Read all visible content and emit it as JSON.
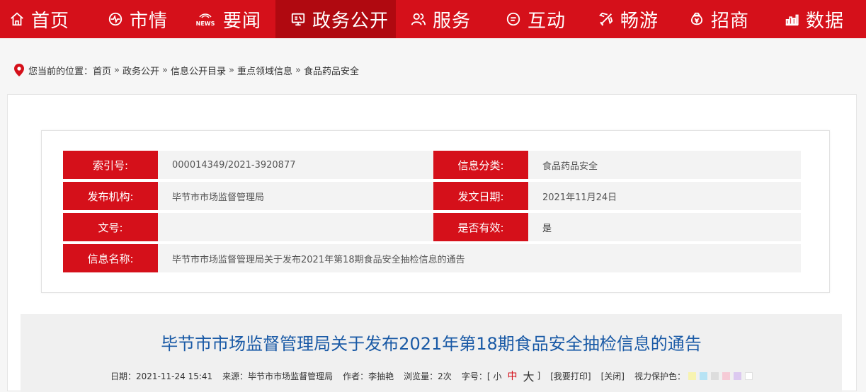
{
  "nav": {
    "items": [
      {
        "label": "首页",
        "icon": "home-icon"
      },
      {
        "label": "市情",
        "icon": "pulse-icon"
      },
      {
        "label": "要闻",
        "icon": "news-icon"
      },
      {
        "label": "政务公开",
        "icon": "monitor-icon"
      },
      {
        "label": "服务",
        "icon": "users-icon"
      },
      {
        "label": "互动",
        "icon": "chat-icon"
      },
      {
        "label": "畅游",
        "icon": "plane-icon"
      },
      {
        "label": "招商",
        "icon": "money-bag-icon"
      },
      {
        "label": "数据",
        "icon": "bar-chart-icon"
      }
    ],
    "news_badge": "NEWS",
    "active_index": 3,
    "accent": "#d5101a",
    "active_bg": "#b00910"
  },
  "breadcrumb": {
    "prefix": "您当前的位置：",
    "separator": "»",
    "items": [
      "首页",
      "政务公开",
      "信息公开目录",
      "重点领域信息",
      "食品药品安全"
    ]
  },
  "meta": {
    "index_no_label": "索引号:",
    "index_no": "000014349/2021-3920877",
    "category_label": "信息分类:",
    "category": "食品药品安全",
    "publisher_label": "发布机构:",
    "publisher": "毕节市市场监督管理局",
    "date_label": "发文日期:",
    "date": "2021年11月24日",
    "doc_no_label": "文号:",
    "doc_no": "",
    "valid_label": "是否有效:",
    "valid": "是",
    "name_label": "信息名称:",
    "name": "毕节市市场监督管理局关于发布2021年第18期食品安全抽检信息的通告"
  },
  "article": {
    "title": "毕节市市场监督管理局关于发布2021年第18期食品安全抽检信息的通告",
    "date": "日期：2021-11-24 15:41",
    "source": "来源：毕节市市场监督管理局",
    "author": "作者：李抽艳",
    "views": "浏览量：2次",
    "font_size_label": "字号：[",
    "font_small": "小",
    "font_medium": "中",
    "font_large": "大",
    "font_size_end": "]",
    "print": "[我要打印]",
    "close": "[关闭]",
    "eye_care_label": "视力保护色：",
    "eye_care_colors": [
      "#f7f3b0",
      "#b7e3f4",
      "#dddddd",
      "#f6cbd6",
      "#dcc9f0",
      "#ffffff"
    ]
  }
}
